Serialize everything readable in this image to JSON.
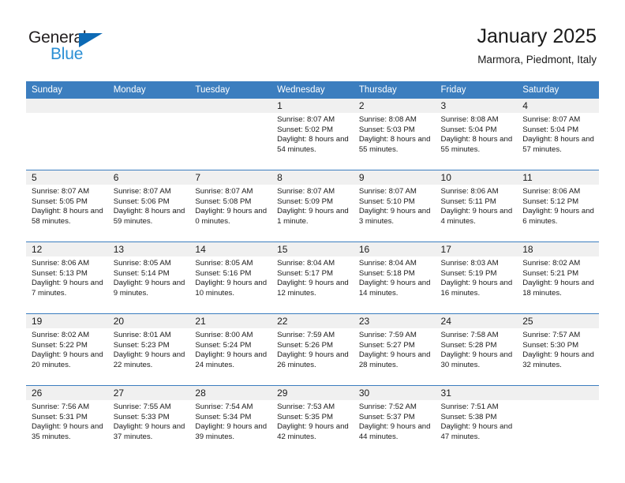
{
  "brand": {
    "line1": "General",
    "line2": "Blue",
    "triangle_color": "#0d6ab5",
    "blue_text_color": "#2b8fd4"
  },
  "header": {
    "title": "January 2025",
    "subtitle": "Marmora, Piedmont, Italy"
  },
  "theme": {
    "header_row_bg": "#3c7ebf",
    "daynum_band_bg": "#f0f0f0",
    "cell_bg": "#ffffff",
    "text_color": "#1a1a1a"
  },
  "weekday_headers": [
    "Sunday",
    "Monday",
    "Tuesday",
    "Wednesday",
    "Thursday",
    "Friday",
    "Saturday"
  ],
  "weeks": [
    [
      {
        "day": "",
        "sunrise": "",
        "sunset": "",
        "daylight": ""
      },
      {
        "day": "",
        "sunrise": "",
        "sunset": "",
        "daylight": ""
      },
      {
        "day": "",
        "sunrise": "",
        "sunset": "",
        "daylight": ""
      },
      {
        "day": "1",
        "sunrise": "Sunrise: 8:07 AM",
        "sunset": "Sunset: 5:02 PM",
        "daylight": "Daylight: 8 hours and 54 minutes."
      },
      {
        "day": "2",
        "sunrise": "Sunrise: 8:08 AM",
        "sunset": "Sunset: 5:03 PM",
        "daylight": "Daylight: 8 hours and 55 minutes."
      },
      {
        "day": "3",
        "sunrise": "Sunrise: 8:08 AM",
        "sunset": "Sunset: 5:04 PM",
        "daylight": "Daylight: 8 hours and 55 minutes."
      },
      {
        "day": "4",
        "sunrise": "Sunrise: 8:07 AM",
        "sunset": "Sunset: 5:04 PM",
        "daylight": "Daylight: 8 hours and 57 minutes."
      }
    ],
    [
      {
        "day": "5",
        "sunrise": "Sunrise: 8:07 AM",
        "sunset": "Sunset: 5:05 PM",
        "daylight": "Daylight: 8 hours and 58 minutes."
      },
      {
        "day": "6",
        "sunrise": "Sunrise: 8:07 AM",
        "sunset": "Sunset: 5:06 PM",
        "daylight": "Daylight: 8 hours and 59 minutes."
      },
      {
        "day": "7",
        "sunrise": "Sunrise: 8:07 AM",
        "sunset": "Sunset: 5:08 PM",
        "daylight": "Daylight: 9 hours and 0 minutes."
      },
      {
        "day": "8",
        "sunrise": "Sunrise: 8:07 AM",
        "sunset": "Sunset: 5:09 PM",
        "daylight": "Daylight: 9 hours and 1 minute."
      },
      {
        "day": "9",
        "sunrise": "Sunrise: 8:07 AM",
        "sunset": "Sunset: 5:10 PM",
        "daylight": "Daylight: 9 hours and 3 minutes."
      },
      {
        "day": "10",
        "sunrise": "Sunrise: 8:06 AM",
        "sunset": "Sunset: 5:11 PM",
        "daylight": "Daylight: 9 hours and 4 minutes."
      },
      {
        "day": "11",
        "sunrise": "Sunrise: 8:06 AM",
        "sunset": "Sunset: 5:12 PM",
        "daylight": "Daylight: 9 hours and 6 minutes."
      }
    ],
    [
      {
        "day": "12",
        "sunrise": "Sunrise: 8:06 AM",
        "sunset": "Sunset: 5:13 PM",
        "daylight": "Daylight: 9 hours and 7 minutes."
      },
      {
        "day": "13",
        "sunrise": "Sunrise: 8:05 AM",
        "sunset": "Sunset: 5:14 PM",
        "daylight": "Daylight: 9 hours and 9 minutes."
      },
      {
        "day": "14",
        "sunrise": "Sunrise: 8:05 AM",
        "sunset": "Sunset: 5:16 PM",
        "daylight": "Daylight: 9 hours and 10 minutes."
      },
      {
        "day": "15",
        "sunrise": "Sunrise: 8:04 AM",
        "sunset": "Sunset: 5:17 PM",
        "daylight": "Daylight: 9 hours and 12 minutes."
      },
      {
        "day": "16",
        "sunrise": "Sunrise: 8:04 AM",
        "sunset": "Sunset: 5:18 PM",
        "daylight": "Daylight: 9 hours and 14 minutes."
      },
      {
        "day": "17",
        "sunrise": "Sunrise: 8:03 AM",
        "sunset": "Sunset: 5:19 PM",
        "daylight": "Daylight: 9 hours and 16 minutes."
      },
      {
        "day": "18",
        "sunrise": "Sunrise: 8:02 AM",
        "sunset": "Sunset: 5:21 PM",
        "daylight": "Daylight: 9 hours and 18 minutes."
      }
    ],
    [
      {
        "day": "19",
        "sunrise": "Sunrise: 8:02 AM",
        "sunset": "Sunset: 5:22 PM",
        "daylight": "Daylight: 9 hours and 20 minutes."
      },
      {
        "day": "20",
        "sunrise": "Sunrise: 8:01 AM",
        "sunset": "Sunset: 5:23 PM",
        "daylight": "Daylight: 9 hours and 22 minutes."
      },
      {
        "day": "21",
        "sunrise": "Sunrise: 8:00 AM",
        "sunset": "Sunset: 5:24 PM",
        "daylight": "Daylight: 9 hours and 24 minutes."
      },
      {
        "day": "22",
        "sunrise": "Sunrise: 7:59 AM",
        "sunset": "Sunset: 5:26 PM",
        "daylight": "Daylight: 9 hours and 26 minutes."
      },
      {
        "day": "23",
        "sunrise": "Sunrise: 7:59 AM",
        "sunset": "Sunset: 5:27 PM",
        "daylight": "Daylight: 9 hours and 28 minutes."
      },
      {
        "day": "24",
        "sunrise": "Sunrise: 7:58 AM",
        "sunset": "Sunset: 5:28 PM",
        "daylight": "Daylight: 9 hours and 30 minutes."
      },
      {
        "day": "25",
        "sunrise": "Sunrise: 7:57 AM",
        "sunset": "Sunset: 5:30 PM",
        "daylight": "Daylight: 9 hours and 32 minutes."
      }
    ],
    [
      {
        "day": "26",
        "sunrise": "Sunrise: 7:56 AM",
        "sunset": "Sunset: 5:31 PM",
        "daylight": "Daylight: 9 hours and 35 minutes."
      },
      {
        "day": "27",
        "sunrise": "Sunrise: 7:55 AM",
        "sunset": "Sunset: 5:33 PM",
        "daylight": "Daylight: 9 hours and 37 minutes."
      },
      {
        "day": "28",
        "sunrise": "Sunrise: 7:54 AM",
        "sunset": "Sunset: 5:34 PM",
        "daylight": "Daylight: 9 hours and 39 minutes."
      },
      {
        "day": "29",
        "sunrise": "Sunrise: 7:53 AM",
        "sunset": "Sunset: 5:35 PM",
        "daylight": "Daylight: 9 hours and 42 minutes."
      },
      {
        "day": "30",
        "sunrise": "Sunrise: 7:52 AM",
        "sunset": "Sunset: 5:37 PM",
        "daylight": "Daylight: 9 hours and 44 minutes."
      },
      {
        "day": "31",
        "sunrise": "Sunrise: 7:51 AM",
        "sunset": "Sunset: 5:38 PM",
        "daylight": "Daylight: 9 hours and 47 minutes."
      },
      {
        "day": "",
        "sunrise": "",
        "sunset": "",
        "daylight": ""
      }
    ]
  ]
}
